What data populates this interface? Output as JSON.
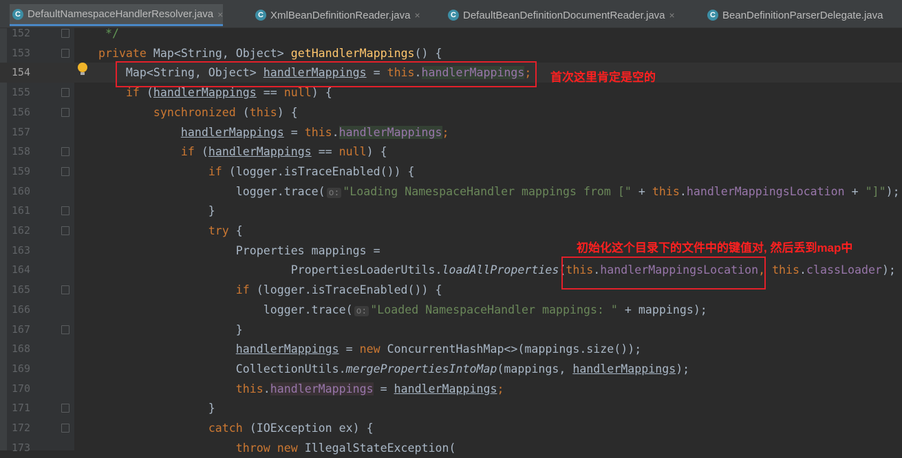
{
  "tabs": [
    {
      "label": "DefaultNamespaceHandlerResolver.java",
      "active": true
    },
    {
      "label": "XmlBeanDefinitionReader.java",
      "active": false
    },
    {
      "label": "DefaultBeanDefinitionDocumentReader.java",
      "active": false
    },
    {
      "label": "BeanDefinitionParserDelegate.java",
      "active": false
    }
  ],
  "close_glyph": "×",
  "class_icon": "C",
  "annotations": [
    "首次这里肯定是空的",
    "初始化这个目录下的文件中的键值对, 然后丢到map中"
  ],
  "lines": [
    {
      "n": "152",
      "t": [
        [
          "    "
        ],
        [
          " */",
          "c"
        ]
      ]
    },
    {
      "n": "153",
      "t": [
        [
          "    "
        ],
        [
          "private ",
          "k"
        ],
        [
          "Map<String, Object> "
        ],
        [
          "getHandlerMappings",
          "m"
        ],
        [
          "() {"
        ]
      ]
    },
    {
      "n": "154",
      "t": [
        [
          "        Map<String, Object> "
        ],
        [
          "handlerMappings",
          "u"
        ],
        [
          " = "
        ],
        [
          "this",
          "k"
        ],
        [
          "."
        ],
        [
          "handlerMappings",
          "f hl"
        ],
        [
          ";",
          "k"
        ]
      ]
    },
    {
      "n": "155",
      "t": [
        [
          "        "
        ],
        [
          "if ",
          "k"
        ],
        [
          "("
        ],
        [
          "handlerMappings",
          "u"
        ],
        [
          " == "
        ],
        [
          "null",
          "k"
        ],
        [
          ") {"
        ]
      ]
    },
    {
      "n": "156",
      "t": [
        [
          "            "
        ],
        [
          "synchronized ",
          "k"
        ],
        [
          "("
        ],
        [
          "this",
          "k"
        ],
        [
          ") {"
        ]
      ]
    },
    {
      "n": "157",
      "t": [
        [
          "                "
        ],
        [
          "handlerMappings",
          "u"
        ],
        [
          " = "
        ],
        [
          "this",
          "k"
        ],
        [
          "."
        ],
        [
          "handlerMappings",
          "f hl"
        ],
        [
          ";",
          "k"
        ]
      ]
    },
    {
      "n": "158",
      "t": [
        [
          "                "
        ],
        [
          "if ",
          "k"
        ],
        [
          "("
        ],
        [
          "handlerMappings",
          "u"
        ],
        [
          " == "
        ],
        [
          "null",
          "k"
        ],
        [
          ") {"
        ]
      ]
    },
    {
      "n": "159",
      "t": [
        [
          "                    "
        ],
        [
          "if ",
          "k"
        ],
        [
          "(logger.isTraceEnabled()) {"
        ]
      ]
    },
    {
      "n": "160",
      "t": [
        [
          "                        logger.trace("
        ],
        [
          "o:",
          "h"
        ],
        [
          "\"Loading NamespaceHandler mappings from [\"",
          "s"
        ],
        [
          " + "
        ],
        [
          "this",
          "k"
        ],
        [
          "."
        ],
        [
          "handlerMappingsLocation",
          "f"
        ],
        [
          " + "
        ],
        [
          "\"]\"",
          "s"
        ],
        [
          ");"
        ]
      ]
    },
    {
      "n": "161",
      "t": [
        [
          "                    }"
        ]
      ]
    },
    {
      "n": "162",
      "t": [
        [
          "                    "
        ],
        [
          "try ",
          "k"
        ],
        [
          "{"
        ]
      ]
    },
    {
      "n": "163",
      "t": [
        [
          "                        Properties mappings ="
        ]
      ]
    },
    {
      "n": "164",
      "t": [
        [
          "                                PropertiesLoaderUtils."
        ],
        [
          "loadAllProperties",
          "i"
        ],
        [
          "("
        ],
        [
          "this",
          "k"
        ],
        [
          "."
        ],
        [
          "handlerMappingsLocation",
          "f"
        ],
        [
          ", ",
          "k"
        ],
        [
          "this",
          "k"
        ],
        [
          "."
        ],
        [
          "classLoader",
          "f"
        ],
        [
          ");"
        ]
      ]
    },
    {
      "n": "165",
      "t": [
        [
          "                        "
        ],
        [
          "if ",
          "k"
        ],
        [
          "(logger.isTraceEnabled()) {"
        ]
      ]
    },
    {
      "n": "166",
      "t": [
        [
          "                            logger.trace("
        ],
        [
          "o:",
          "h"
        ],
        [
          "\"Loaded NamespaceHandler mappings: \"",
          "s"
        ],
        [
          " + mappings);"
        ]
      ]
    },
    {
      "n": "167",
      "t": [
        [
          "                        }"
        ]
      ]
    },
    {
      "n": "168",
      "t": [
        [
          "                        "
        ],
        [
          "handlerMappings",
          "u"
        ],
        [
          " = "
        ],
        [
          "new ",
          "k"
        ],
        [
          "ConcurrentHashMap<>(mappings.size());"
        ]
      ]
    },
    {
      "n": "169",
      "t": [
        [
          "                        CollectionUtils."
        ],
        [
          "mergePropertiesIntoMap",
          "i"
        ],
        [
          "(mappings, "
        ],
        [
          "handlerMappings",
          "u"
        ],
        [
          ");"
        ]
      ]
    },
    {
      "n": "170",
      "t": [
        [
          "                        "
        ],
        [
          "this",
          "k"
        ],
        [
          "."
        ],
        [
          "handlerMappings",
          "f hl2"
        ],
        [
          " = "
        ],
        [
          "handlerMappings",
          "u"
        ],
        [
          ";",
          "k"
        ]
      ]
    },
    {
      "n": "171",
      "t": [
        [
          "                    }"
        ]
      ]
    },
    {
      "n": "172",
      "t": [
        [
          "                    "
        ],
        [
          "catch ",
          "k"
        ],
        [
          "(IOException ex) {"
        ]
      ]
    },
    {
      "n": "173",
      "t": [
        [
          "                        "
        ],
        [
          "throw new ",
          "k"
        ],
        [
          "IllegalStateException("
        ]
      ]
    }
  ]
}
